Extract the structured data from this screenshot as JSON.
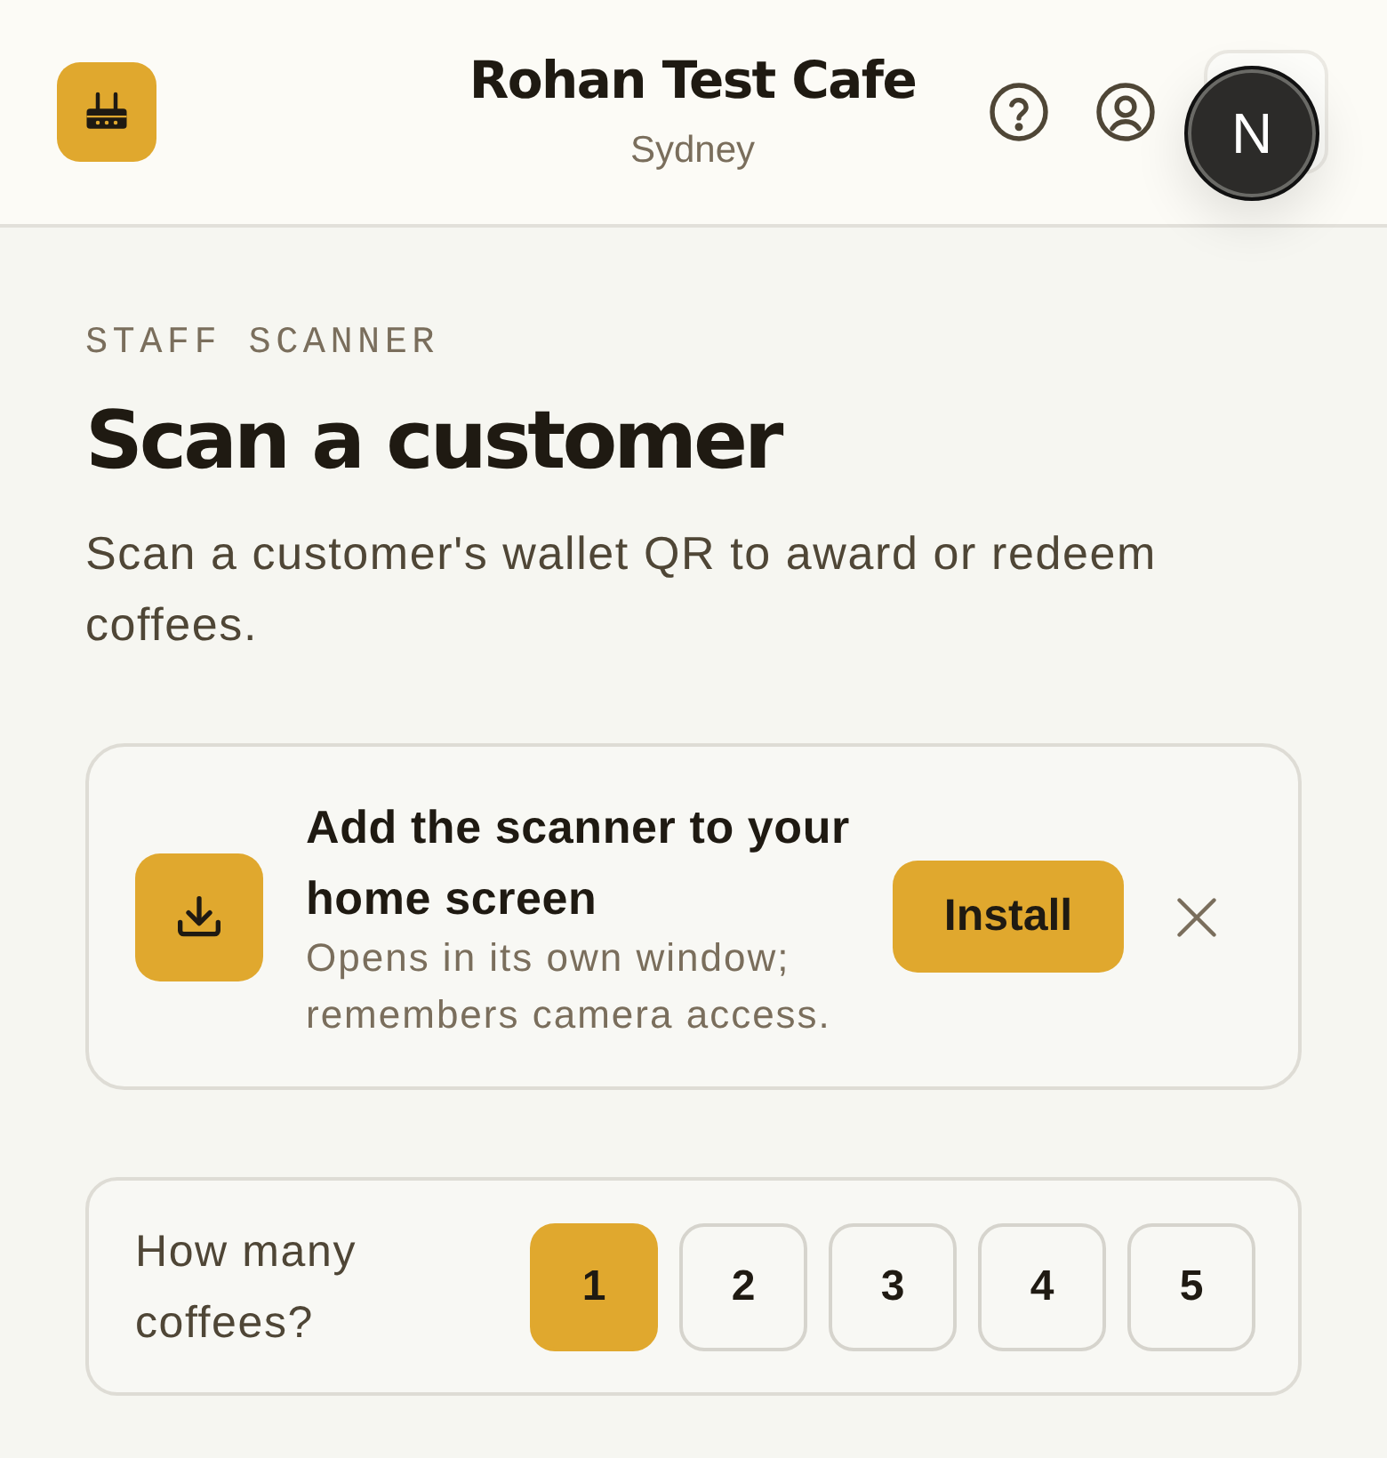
{
  "header": {
    "title": "Rohan Test Cafe",
    "subtitle": "Sydney",
    "dev_badge": "N"
  },
  "intro": {
    "eyebrow": "STAFF SCANNER",
    "heading": "Scan a customer",
    "description": "Scan a customer's wallet QR to award or redeem coffees."
  },
  "install_banner": {
    "title": "Add the scanner to your home screen",
    "subtitle": "Opens in its own window; remembers camera access.",
    "button": "Install"
  },
  "quantity": {
    "label": "How many coffees?",
    "options": [
      {
        "label": "1",
        "selected": true
      },
      {
        "label": "2",
        "selected": false
      },
      {
        "label": "3",
        "selected": false
      },
      {
        "label": "4",
        "selected": false
      },
      {
        "label": "5",
        "selected": false
      }
    ]
  }
}
